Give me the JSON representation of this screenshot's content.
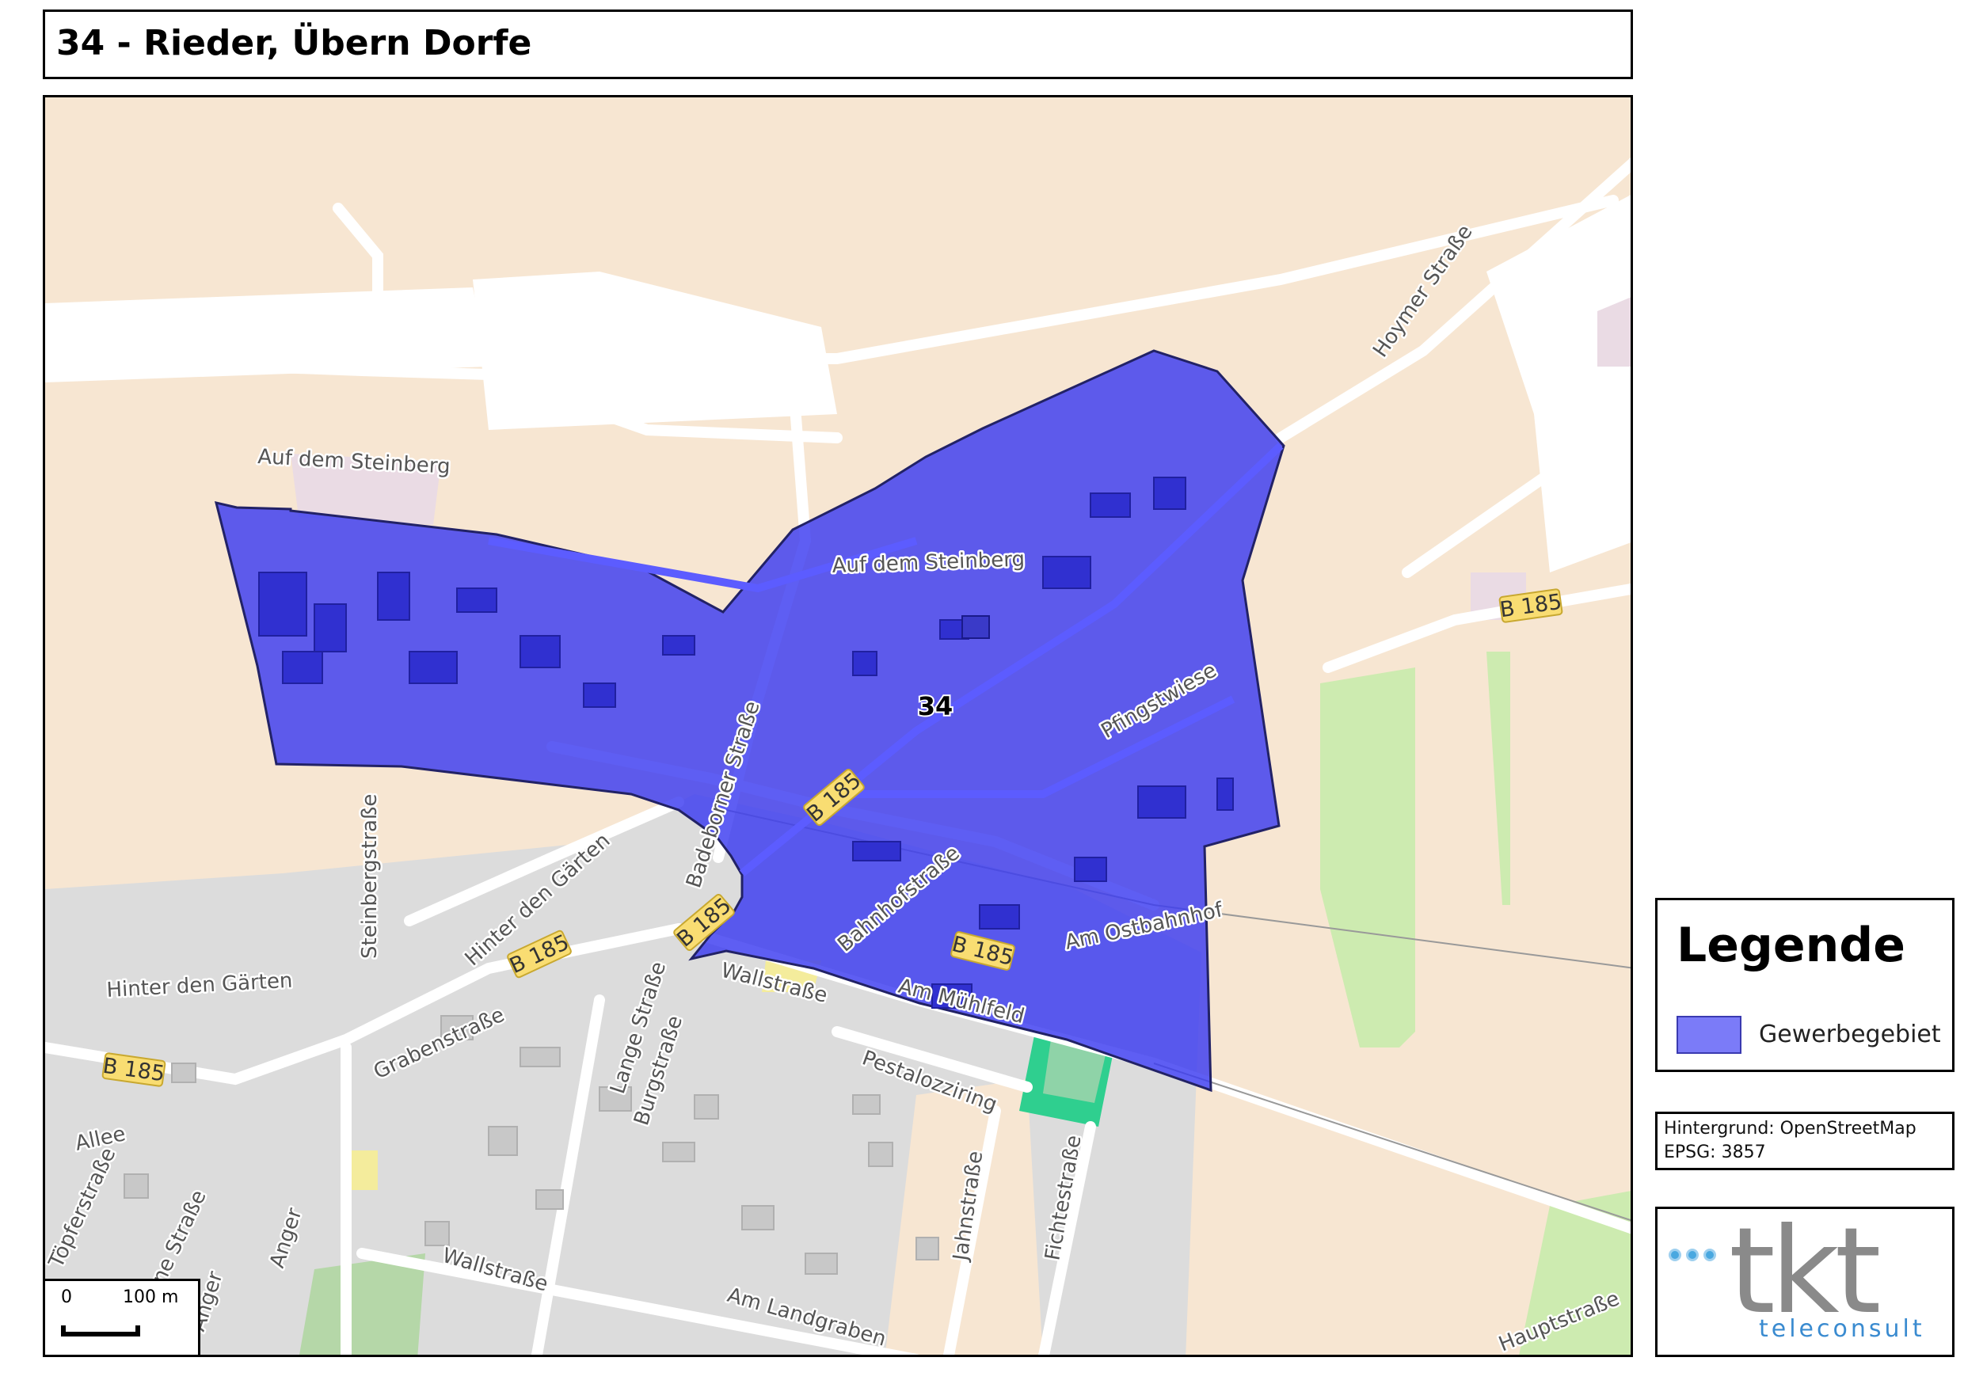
{
  "title": "34 - Rieder, Übern Dorfe",
  "map": {
    "area_label": "34",
    "street_labels": {
      "auf_dem_steinberg_1": "Auf dem Steinberg",
      "auf_dem_steinberg_2": "Auf dem Steinberg",
      "hoymer_strasse": "Hoymer Straße",
      "pfingstwiese": "Pfingstwiese",
      "badebornerstrasse": "Badeborner Straße",
      "steinbergstrasse": "Steinbergstraße",
      "hinter_den_gaerten_1": "Hinter den Gärten",
      "hinter_den_gaerten_2": "Hinter den Gärten",
      "bahnhofstrasse": "Bahnhofstraße",
      "am_ostbahnhof": "Am Ostbahnhof",
      "wallstrasse_1": "Wallstraße",
      "wallstrasse_2": "Wallstraße",
      "am_muehlfeld": "Am Mühlfeld",
      "pestalozziring": "Pestalozziring",
      "grabenstrasse": "Grabenstraße",
      "lange_strasse": "Lange Straße",
      "burgstrasse": "Burgstraße",
      "allee": "Allee",
      "anger_1": "Anger",
      "anger_2": "Anger",
      "toepferstrasse": "Töpferstraße",
      "ne_strasse": "ne Straße",
      "jahnstrasse": "Jahnstraße",
      "fichtestrasse": "Fichtestraße",
      "am_landgraben": "Am Landgraben",
      "hauptstrasse": "Hauptstraße"
    },
    "road_shields": [
      "B 185",
      "B 185",
      "B 185",
      "B 185",
      "B 185",
      "B 185"
    ],
    "scale": {
      "zero": "0",
      "distance": "100 m"
    }
  },
  "legend": {
    "title": "Legende",
    "items": [
      {
        "label": "Gewerbegebiet",
        "color": "#7b7bf8"
      }
    ]
  },
  "source": {
    "line1": "Hintergrund: OpenStreetMap",
    "line2": "EPSG: 3857"
  },
  "logo": {
    "main": "tkt",
    "sub": "teleconsult"
  },
  "colors": {
    "farmland": "#f7e6d2",
    "residential": "#dcdcdc",
    "meadow": "#cdebb0",
    "area_fill": "#3a3af0",
    "road": "#ffffff",
    "shield": "#f9dd72"
  }
}
